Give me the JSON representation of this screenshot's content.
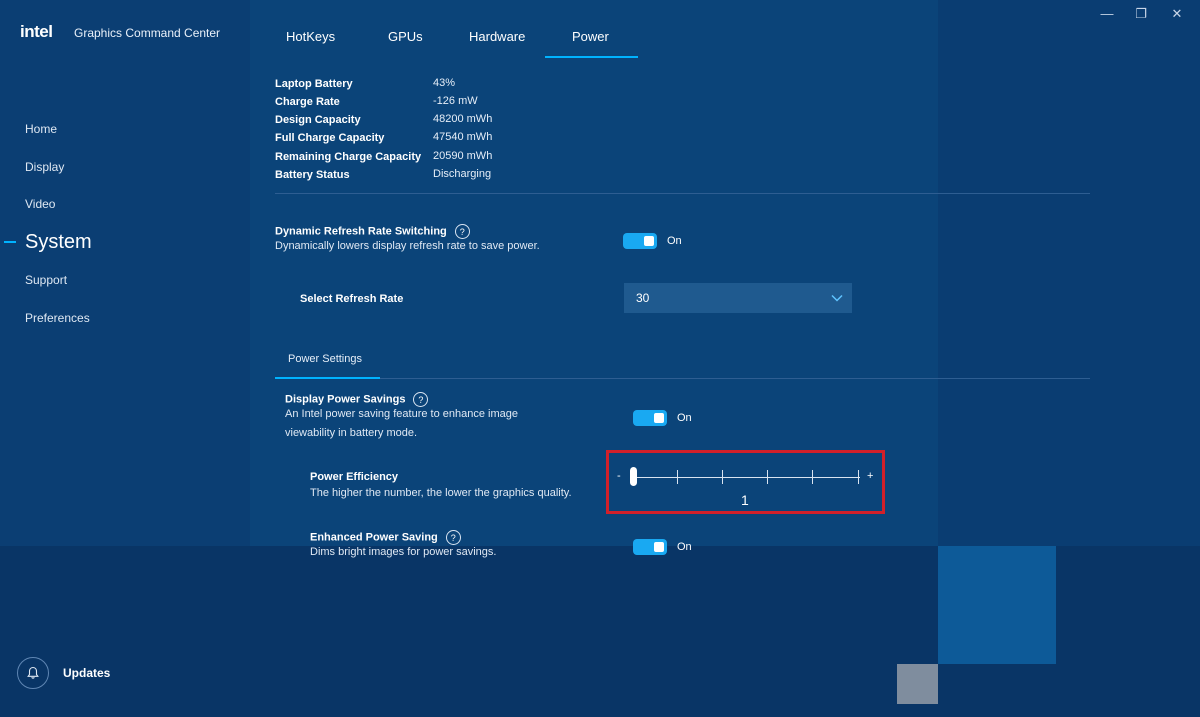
{
  "window": {
    "minimize_glyph": "—",
    "restore_glyph": "❐",
    "close_glyph": "✕"
  },
  "app": {
    "logo": "intel",
    "title": "Graphics Command Center"
  },
  "sidebar": {
    "items": [
      {
        "label": "Home"
      },
      {
        "label": "Display"
      },
      {
        "label": "Video"
      },
      {
        "label": "System",
        "active": true
      },
      {
        "label": "Support"
      },
      {
        "label": "Preferences"
      }
    ],
    "updates_label": "Updates",
    "updates_icon": "bell-icon"
  },
  "tabs": [
    {
      "label": "HotKeys"
    },
    {
      "label": "GPUs"
    },
    {
      "label": "Hardware"
    },
    {
      "label": "Power",
      "active": true
    }
  ],
  "battery": [
    {
      "label": "Laptop Battery",
      "value": "43%"
    },
    {
      "label": "Charge Rate",
      "value": "-126 mW"
    },
    {
      "label": "Design Capacity",
      "value": "48200 mWh"
    },
    {
      "label": "Full Charge Capacity",
      "value": "47540 mWh"
    },
    {
      "label": "Remaining Charge Capacity",
      "value": "20590 mWh"
    },
    {
      "label": "Battery Status",
      "value": "Discharging"
    }
  ],
  "refresh_switching": {
    "title": "Dynamic Refresh Rate Switching",
    "description": "Dynamically lowers display refresh rate to save power.",
    "toggle_label": "On",
    "enabled": true
  },
  "refresh_rate": {
    "label": "Select Refresh Rate",
    "value": "30"
  },
  "power_settings_tab": "Power Settings",
  "display_power_savings": {
    "title": "Display Power Savings",
    "description_line1": "An Intel power saving feature to enhance image",
    "description_line2": "viewability in battery mode.",
    "toggle_label": "On",
    "enabled": true
  },
  "power_efficiency": {
    "title": "Power Efficiency",
    "description": "The higher the number, the lower the graphics quality.",
    "minus": "-",
    "plus": "+",
    "value": "1",
    "min": 1,
    "max": 6
  },
  "enhanced_power_saving": {
    "title": "Enhanced Power Saving",
    "description": "Dims bright images for power savings.",
    "toggle_label": "On",
    "enabled": true
  },
  "colors": {
    "accent": "#00b3ff",
    "toggle_on": "#19a9f2",
    "highlight": "#d2202a"
  }
}
